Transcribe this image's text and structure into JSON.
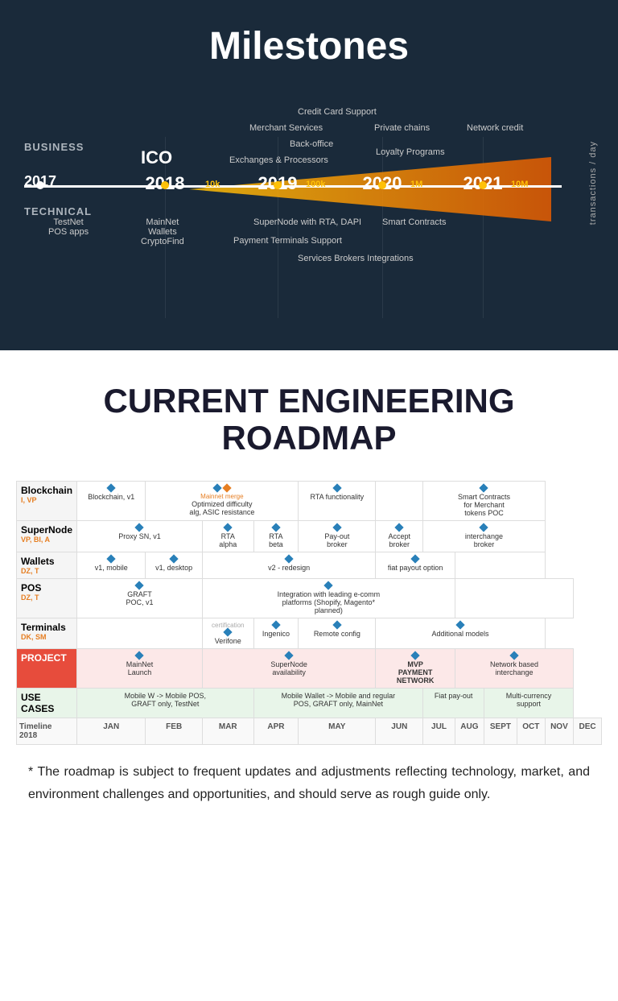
{
  "milestones": {
    "title": "Milestones",
    "business_label": "BUSINESS",
    "technical_label": "TECHNICAL",
    "ico_label": "ICO",
    "transactions_label": "transactions / day",
    "years": [
      "2017",
      "2018",
      "2019",
      "2020",
      "2021"
    ],
    "scales": [
      "10k",
      "100k",
      "1M",
      "10M"
    ],
    "business_items": [
      "Credit Card Support",
      "Merchant Services",
      "Back-office",
      "Exchanges & Processors",
      "Private chains",
      "Loyalty Programs",
      "Network credit",
      "Services Brokers Integrations"
    ],
    "technical_items": [
      "TestNet\nPOS apps",
      "MainNet\nWallets\nCryptoFind",
      "SuperNode with RTA, DAPI",
      "Payment Terminals Support",
      "Smart Contracts",
      "Services Brokers Integrations"
    ]
  },
  "roadmap": {
    "title": "CURRENT ENGINEERING\nROADMAP",
    "rows": [
      {
        "name": "Blockchain",
        "sub": "I, VP",
        "cells": [
          {
            "label": "Blockchain, v1"
          },
          {
            "label": "Optimized difficulty\nalg, ASIC resistance",
            "note": "Mainnet merge"
          },
          {
            "label": "RTA functionality"
          },
          {
            "label": ""
          },
          {
            "label": "Smart Contracts\nfor Merchant\ntokens POC"
          }
        ]
      },
      {
        "name": "SuperNode",
        "sub": "VP, BI, A",
        "cells": [
          {
            "label": "Proxy SN, v1"
          },
          {
            "label": "RTA\nalpha"
          },
          {
            "label": "RTA\nbeta"
          },
          {
            "label": "Pay-out\nbroker"
          },
          {
            "label": "Accept\nbroker"
          },
          {
            "label": "interchange\nbroker"
          }
        ]
      },
      {
        "name": "Wallets",
        "sub": "DZ, T",
        "cells": [
          {
            "label": "v1, mobile"
          },
          {
            "label": "v1, desktop"
          },
          {
            "label": "v2 - redesign"
          },
          {
            "label": "fiat payout option"
          },
          {
            "label": ""
          }
        ]
      },
      {
        "name": "POS",
        "sub": "DZ, T",
        "cells": [
          {
            "label": "GRAFT\nPOC, v1"
          },
          {
            "label": "Integration with leading e-comm\nplatforms (Shopify, Magento*\nplanned)"
          },
          {
            "label": ""
          }
        ]
      },
      {
        "name": "Terminals",
        "sub": "DK, SM",
        "cells": [
          {
            "label": "Verifone",
            "note": "certification"
          },
          {
            "label": "Ingenico"
          },
          {
            "label": "Remote config"
          },
          {
            "label": "Additional models"
          }
        ]
      }
    ],
    "project_row": {
      "label": "PROJECT",
      "cells": [
        {
          "label": "MainNet\nLaunch"
        },
        {
          "label": "SuperNode\navailability"
        },
        {
          "label": "MVP\nPAYMENT\nNETWORK"
        },
        {
          "label": "Network based\ninterchange"
        }
      ]
    },
    "usecases_row": {
      "label": "USE CASES",
      "cells": [
        {
          "label": "Mobile W -> Mobile POS,\nGRAFT only, TestNet"
        },
        {
          "label": "Mobile Wallet -> Mobile and regular\nPOS, GRAFT only, MainNet"
        },
        {
          "label": "Fiat pay-out"
        },
        {
          "label": "Multi-currency\nsupport"
        }
      ]
    },
    "timeline": {
      "label": "Timeline\n2018",
      "months": [
        "JAN",
        "FEB",
        "MAR",
        "APR",
        "MAY",
        "JUN",
        "JUL",
        "AUG",
        "SEPT",
        "OCT",
        "NOV",
        "DEC"
      ]
    }
  },
  "disclaimer": "* The roadmap is subject to frequent updates and adjustments reflecting technology, market, and environment challenges and opportunities, and should serve as rough guide only."
}
